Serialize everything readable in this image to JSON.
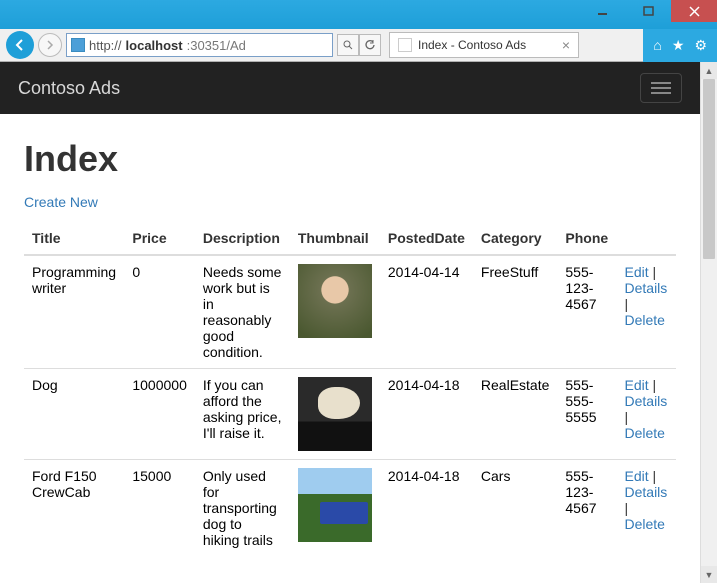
{
  "window": {
    "url_prefix": "http://",
    "url_host": "localhost",
    "url_rest": ":30351/Ad",
    "tab_title": "Index - Contoso Ads"
  },
  "navbar": {
    "brand": "Contoso Ads"
  },
  "page": {
    "heading": "Index",
    "create_link": "Create New"
  },
  "table": {
    "headers": [
      "Title",
      "Price",
      "Description",
      "Thumbnail",
      "PostedDate",
      "Category",
      "Phone"
    ],
    "rows": [
      {
        "title": "Programming writer",
        "price": "0",
        "description": "Needs some work but is in reasonably good condition.",
        "posted": "2014-04-14",
        "category": "FreeStuff",
        "phone": "555-123-4567",
        "thumb": "thumb-person"
      },
      {
        "title": "Dog",
        "price": "1000000",
        "description": "If you can afford the asking price, I'll raise it.",
        "posted": "2014-04-18",
        "category": "RealEstate",
        "phone": "555-555-5555",
        "thumb": "thumb-dog"
      },
      {
        "title": "Ford F150 CrewCab",
        "price": "15000",
        "description": "Only used for transporting dog to hiking trails",
        "posted": "2014-04-18",
        "category": "Cars",
        "phone": "555-123-4567",
        "thumb": "thumb-truck"
      }
    ],
    "actions": {
      "edit": "Edit",
      "details": "Details",
      "delete": "Delete"
    }
  }
}
